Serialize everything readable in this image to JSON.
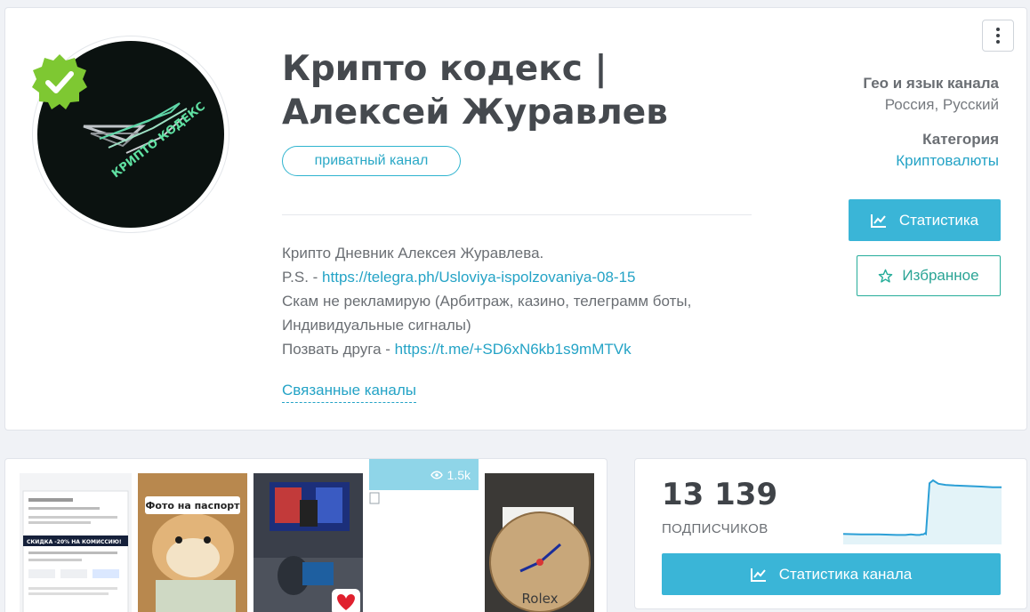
{
  "channel": {
    "title": "Крипто кодекс | Алексей Журавлев",
    "type_label": "приватный канал",
    "verified": true,
    "avatar_text": "КРИПТО КОДЕКС",
    "description": {
      "line1": "Крипто Дневник Алексея Журавлева.",
      "line2_prefix": "P.S. - ",
      "line2_link": "https://telegra.ph/Usloviya-ispolzovaniya-08-15",
      "line3": "Скам не рекламирую (Арбитраж, казино, телеграмм боты,",
      "line4": "Индивидуальные сигналы)",
      "line5_prefix": "Позвать друга - ",
      "line5_link": "https://t.me/+SD6xN6kb1s9mMTVk"
    },
    "related_label": "Связанные каналы"
  },
  "meta": {
    "geo_label": "Гео и язык канала",
    "geo_value": "Россия, Русский",
    "category_label": "Категория",
    "category_value": "Криптовалюты"
  },
  "buttons": {
    "stats": "Статистика",
    "favorite": "Избранное",
    "channel_stats": "Статистика канала"
  },
  "posts": {
    "thumb2_caption": "Фото на паспорт",
    "thumb5_caption": "Rolex",
    "thumb1_banner": "СКИДКА -20% НА КОМИССИЮ!",
    "views": "1.5k"
  },
  "subscribers": {
    "count": "13 139",
    "label": "ПОДПИСЧИКОВ",
    "trend": [
      0.06,
      0.05,
      0.05,
      0.04,
      0.04,
      0.05,
      0.04,
      0.04,
      0.05,
      0.05,
      0.06,
      0.07,
      0.06,
      0.95,
      1.0,
      0.94,
      0.92,
      0.91,
      0.9,
      0.89,
      0.88,
      0.88
    ]
  },
  "colors": {
    "accent": "#3ab5d7",
    "favorite": "#26ad9a",
    "link": "#24a3c6",
    "verified": "#7ec832"
  },
  "icons": [
    "more-vertical-icon",
    "verified-badge-icon",
    "chart-line-icon",
    "star-outline-icon",
    "eye-icon"
  ]
}
